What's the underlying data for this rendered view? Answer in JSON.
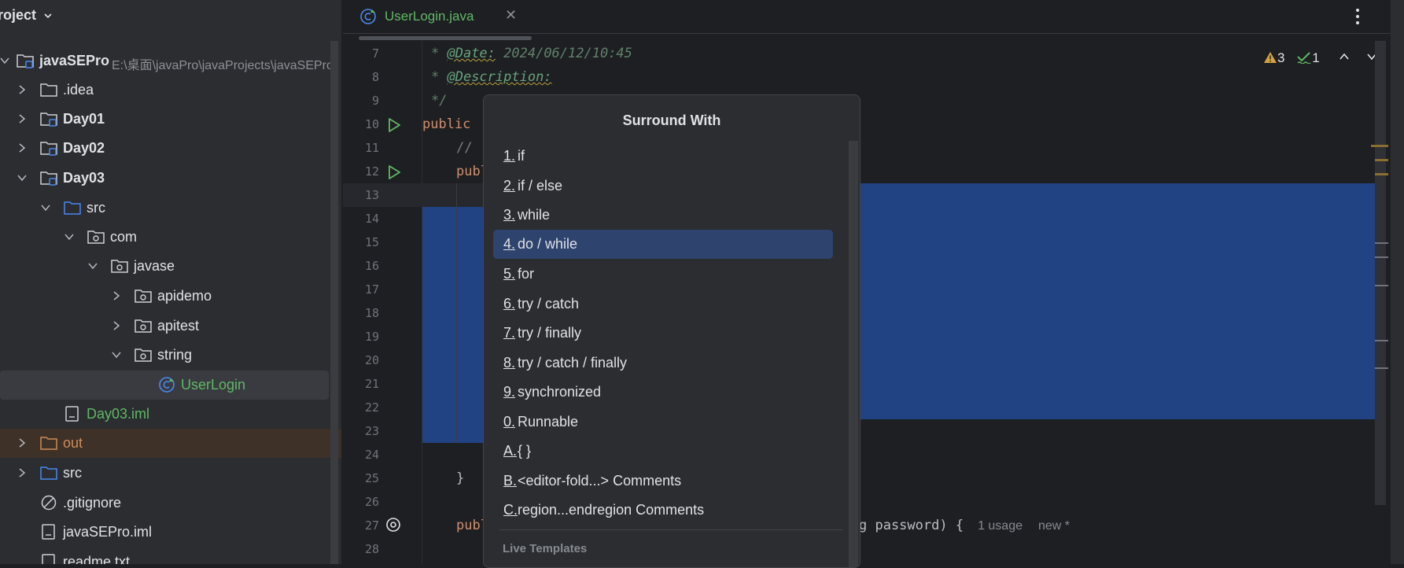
{
  "project": {
    "title": "roject",
    "tree": [
      {
        "label": "javaSEPro",
        "path": "E:\\桌面\\javaPro\\javaProjects\\javaSEPro",
        "bold": true
      },
      {
        "label": ".idea"
      },
      {
        "label": "Day01",
        "bold": true
      },
      {
        "label": "Day02",
        "bold": true
      },
      {
        "label": "Day03",
        "bold": true
      },
      {
        "label": "src"
      },
      {
        "label": "com"
      },
      {
        "label": "javase"
      },
      {
        "label": "apidemo"
      },
      {
        "label": "apitest"
      },
      {
        "label": "string"
      },
      {
        "label": "UserLogin"
      },
      {
        "label": "Day03.iml"
      },
      {
        "label": "out"
      },
      {
        "label": "src"
      },
      {
        "label": ".gitignore"
      },
      {
        "label": "javaSEPro.iml"
      },
      {
        "label": "readme.txt"
      }
    ]
  },
  "editor": {
    "tab_label": "UserLogin.java",
    "tab_close": "✕",
    "line_numbers": [
      "7",
      "8",
      "9",
      "10",
      "11",
      "12",
      "13",
      "14",
      "15",
      "16",
      "17",
      "18",
      "19",
      "20",
      "21",
      "22",
      "23",
      "24",
      "25",
      "26",
      "27",
      "28"
    ],
    "code": {
      "l7_star": "* ",
      "l7_tag": "@Date:",
      "l7_val": " 2024/06/12/10:45",
      "l8_star": "* ",
      "l8_tag": "@Description:",
      "l9": "*/",
      "l10": "public",
      "l11": "//",
      "l12": "publ",
      "l25": "}",
      "l27_kw": "publ",
      "l27_rest": "g password) {",
      "l27_usage": "1 usage",
      "l27_new": "new *"
    },
    "inspections": {
      "warnings": "3",
      "checks": "1"
    }
  },
  "popup": {
    "title": "Surround With",
    "items": [
      {
        "key": "1.",
        "text": "if"
      },
      {
        "key": "2.",
        "text": "if / else"
      },
      {
        "key": "3.",
        "text": "while"
      },
      {
        "key": "4.",
        "text": "do / while"
      },
      {
        "key": "5.",
        "text": "for"
      },
      {
        "key": "6.",
        "text": "try / catch"
      },
      {
        "key": "7.",
        "text": "try / finally"
      },
      {
        "key": "8.",
        "text": "try / catch / finally"
      },
      {
        "key": "9.",
        "text": "synchronized"
      },
      {
        "key": "0.",
        "text": "Runnable"
      },
      {
        "key": "A.",
        "text": "{ }"
      },
      {
        "key": "B.",
        "text": "<editor-fold...> Comments"
      },
      {
        "key": "C.",
        "text": "region...endregion Comments"
      }
    ],
    "selected_index": 3,
    "section_label": "Live Templates"
  },
  "colors": {
    "selection": "#214283",
    "accent_green": "#5fb865",
    "popup_highlight": "#2e436e",
    "warning": "#d4a23f"
  }
}
